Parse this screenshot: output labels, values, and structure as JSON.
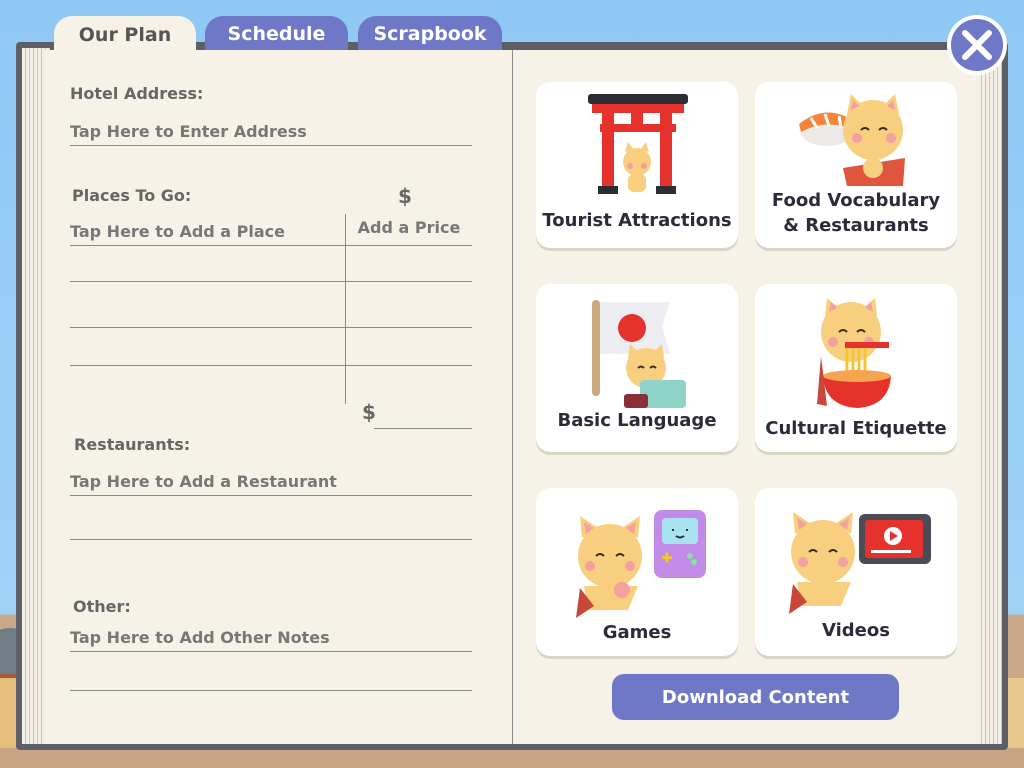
{
  "tabs": [
    {
      "label": "Our Plan"
    },
    {
      "label": "Schedule"
    },
    {
      "label": "Scrapbook"
    }
  ],
  "plan": {
    "hotel_label": "Hotel Address:",
    "hotel_placeholder": "Tap Here to Enter Address",
    "places_label": "Places To Go:",
    "price_header_symbol": "$",
    "place_placeholder": "Tap Here to Add a Place",
    "price_placeholder": "Add a Price",
    "total_symbol": "$",
    "restaurants_label": "Restaurants:",
    "restaurant_placeholder": "Tap Here to Add a Restaurant",
    "other_label": "Other:",
    "other_placeholder": "Tap Here to Add Other Notes"
  },
  "cards": [
    {
      "label": "Tourist Attractions",
      "icon": "torii-gate-icon"
    },
    {
      "label": "Food Vocabulary & Restaurants",
      "icon": "sushi-cat-icon"
    },
    {
      "label": "Basic Language",
      "icon": "japan-flag-icon"
    },
    {
      "label": "Cultural Etiquette",
      "icon": "ramen-cat-icon"
    },
    {
      "label": "Games",
      "icon": "game-console-icon"
    },
    {
      "label": "Videos",
      "icon": "video-player-icon"
    }
  ],
  "download_label": "Download Content",
  "colors": {
    "accent": "#6e78c7",
    "paper": "#f6f2e8",
    "text_dark": "#2b2b3a"
  }
}
